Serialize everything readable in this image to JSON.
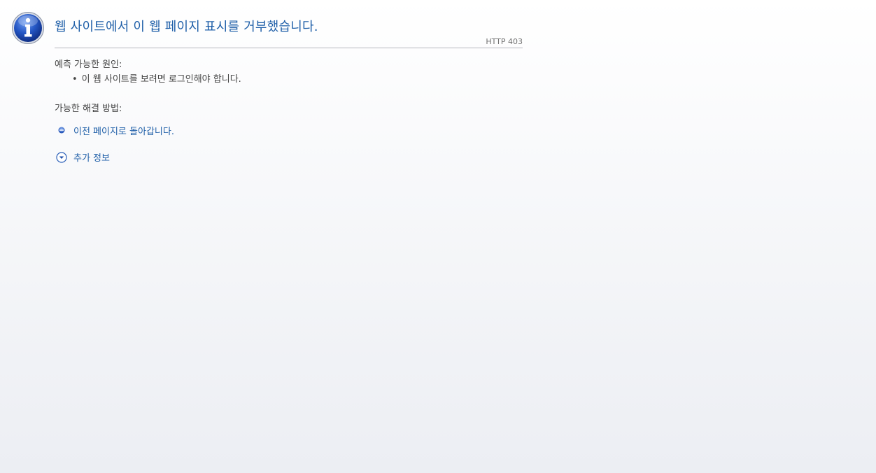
{
  "header": {
    "title": "웹 사이트에서 이 웹 페이지 표시를 거부했습니다.",
    "http_code": "HTTP 403"
  },
  "causes": {
    "label": "예측 가능한 원인:",
    "items": [
      {
        "bullet": "•",
        "text": "이 웹 사이트를 보려면 로그인해야 합니다."
      }
    ]
  },
  "solutions": {
    "label": "가능한 해결 방법:",
    "back_link": "이전 페이지로 돌아갑니다.",
    "more_info_link": "추가 정보"
  },
  "icons": {
    "header": "info-icon",
    "back": "back-bullet-icon",
    "more": "expand-chevron-icon"
  },
  "colors": {
    "title": "#1f5fa8",
    "link": "#1f5fa8",
    "text": "#444444",
    "icon_blue": "#1e4fb4"
  }
}
